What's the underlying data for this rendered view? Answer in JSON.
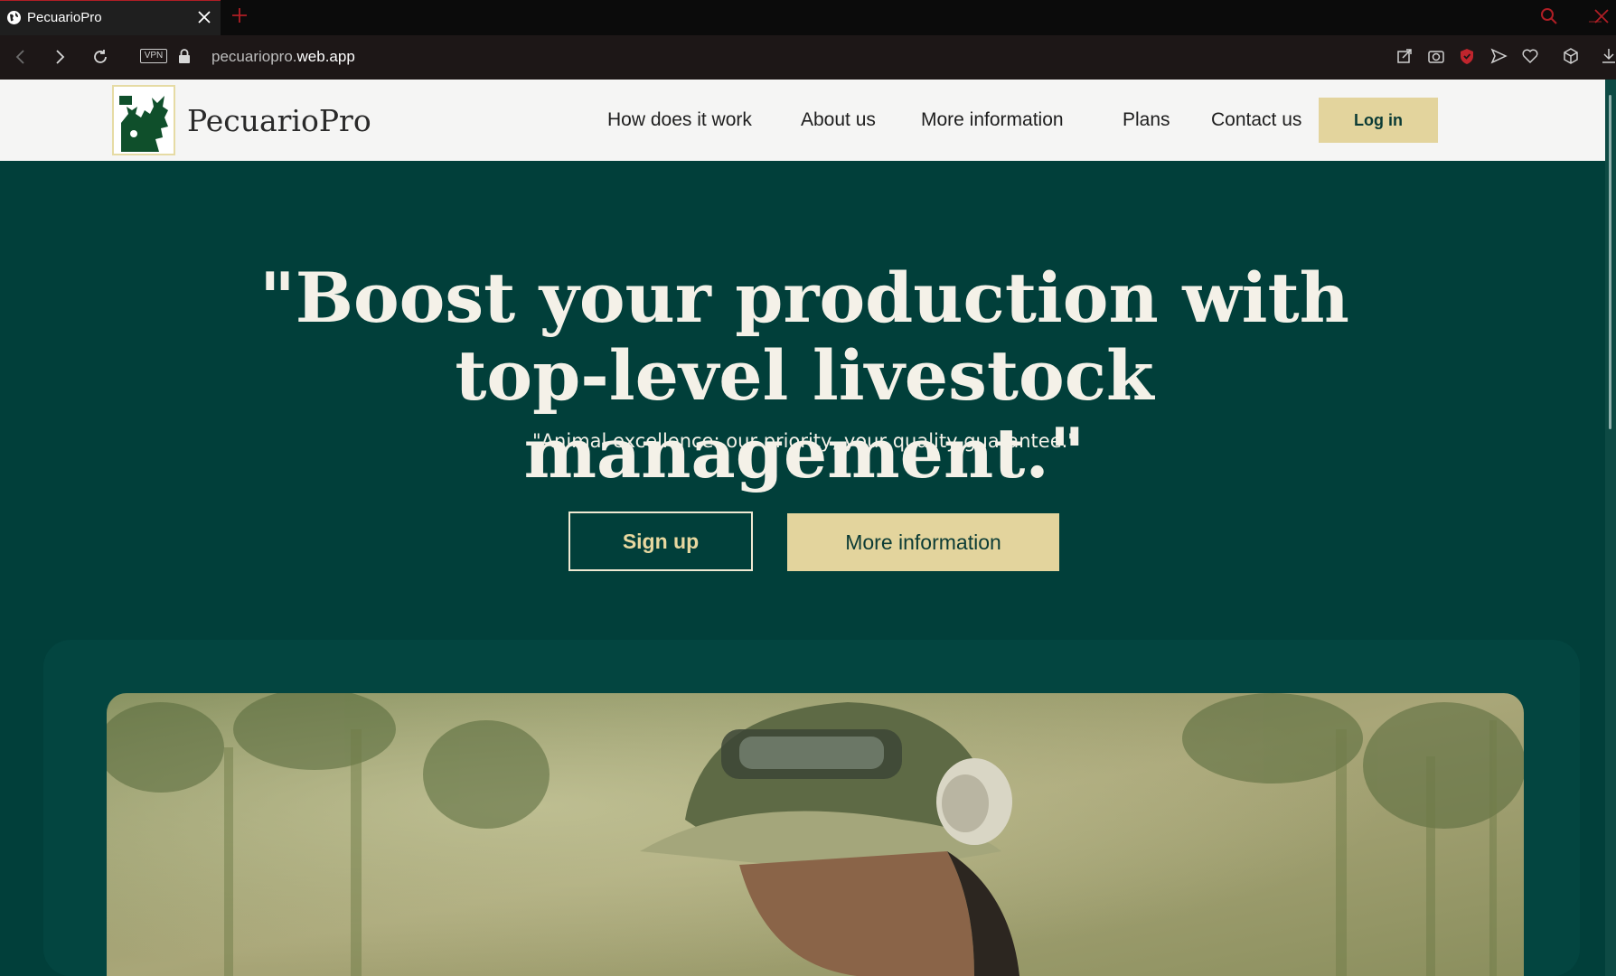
{
  "browser": {
    "tab_title": "PecuarioPro",
    "vpn_label": "VPN",
    "url_prefix": "pecuariopro.",
    "url_host": "web.app"
  },
  "site": {
    "brand": "PecuarioPro",
    "menu": [
      "How does it work",
      "About us",
      "More information",
      "Plans",
      "Contact us"
    ],
    "login_label": "Log in"
  },
  "hero": {
    "headline": "\"Boost your production with top-level livestock management.\"",
    "tagline": "\"Animal excellence: our priority, your quality guarantee.\"",
    "signup_label": "Sign up",
    "more_label": "More information"
  },
  "colors": {
    "hero_bg": "#013f3a",
    "accent": "#e3d49d",
    "nav_bg": "#f5f5f4"
  }
}
